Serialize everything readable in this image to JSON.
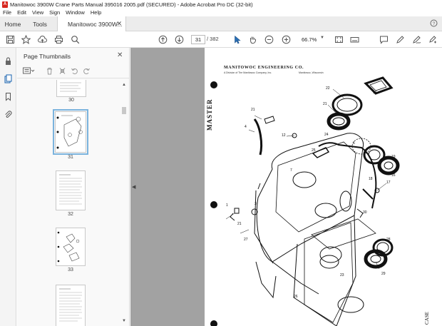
{
  "window": {
    "title": "Manitowoc 3900W Crane Parts Manual 395016 2005.pdf (SECURED) - Adobe Acrobat Pro DC (32-bit)"
  },
  "menu": [
    "File",
    "Edit",
    "View",
    "Sign",
    "Window",
    "Help"
  ],
  "tabs": {
    "home": "Home",
    "tools": "Tools",
    "document": "Manitowoc 3900W..."
  },
  "toolbar": {
    "current_page": "31",
    "total_pages": "/ 382",
    "zoom": "66.7%"
  },
  "thumbnails": {
    "title": "Page Thumbnails",
    "pages": [
      {
        "label": "30"
      },
      {
        "label": "31",
        "selected": true
      },
      {
        "label": "32"
      },
      {
        "label": "33"
      }
    ]
  },
  "document": {
    "header": "MANITOWOC ENGINEERING CO.",
    "subheader": "A Division of The Manitowoc Company, Inc.",
    "location": "Manitowoc, Wisconsin",
    "side_text": "MASTER",
    "corner_text": "CASE"
  },
  "colors": {
    "acrobat_red": "#d7261e",
    "selection_blue": "#7bb3dd",
    "doc_background": "#a2a2a2"
  }
}
